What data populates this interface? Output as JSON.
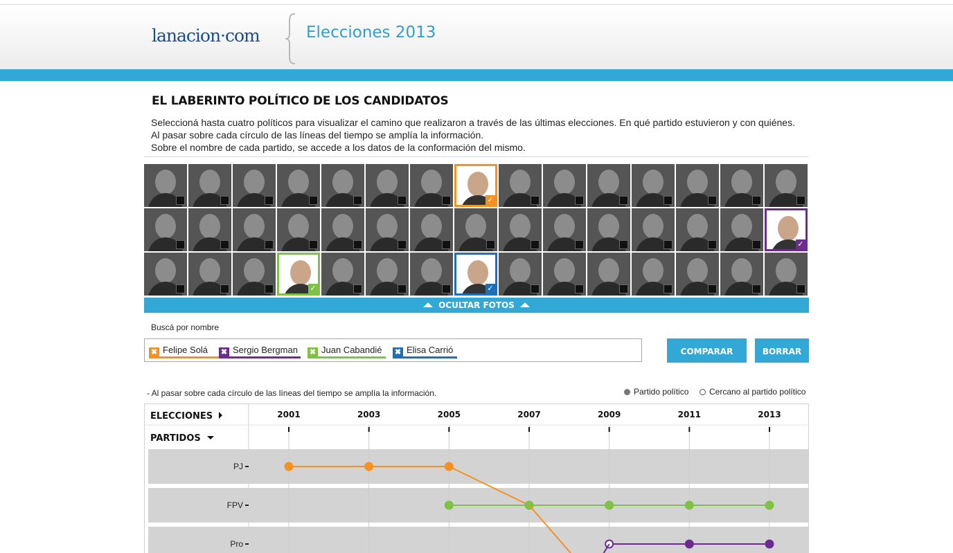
{
  "header": {
    "logo": "lanacion·com",
    "section": "Elecciones 2013"
  },
  "intro": {
    "title": "EL LABERINTO POLÍTICO DE LOS CANDIDATOS",
    "lines": [
      "Seleccioná hasta cuatro políticos para visualizar el camino que realizaron a través de las últimas elecciones. En qué partido estuvieron y con quiénes.",
      "Al pasar sobre cada círculo de las líneas del tiempo se amplía la información.",
      "Sobre el nombre de cada partido, se accede a los datos de la conformación del mismo."
    ]
  },
  "photo_grid": {
    "columns": 15,
    "rows": 3,
    "selected": [
      {
        "row": 0,
        "col": 7,
        "color": "#f39223"
      },
      {
        "row": 1,
        "col": 14,
        "color": "#6a2c8f"
      },
      {
        "row": 2,
        "col": 3,
        "color": "#7dc242"
      },
      {
        "row": 2,
        "col": 7,
        "color": "#1f6fb8"
      }
    ],
    "toggle_label": "OCULTAR FOTOS"
  },
  "search": {
    "label": "Buscá por nombre",
    "tags": [
      {
        "name": "Felipe Solá",
        "color": "#f39223"
      },
      {
        "name": "Sergio Bergman",
        "color": "#6a2c8f"
      },
      {
        "name": "Juan Cabandié",
        "color": "#7dc242"
      },
      {
        "name": "Elisa Carrió",
        "color": "#1f6fb8"
      }
    ],
    "compare_label": "COMPARAR",
    "clear_label": "BORRAR"
  },
  "chart_info": {
    "hint": "- Al pasar sobre cada círculo de las líneas del tiempo se amplía la información.",
    "legend_party": "Partido político",
    "legend_near": "Cercano al partido político",
    "elections_label": "ELECCIONES",
    "parties_label": "PARTIDOS"
  },
  "chart_data": {
    "type": "line",
    "x": [
      2001,
      2003,
      2005,
      2007,
      2009,
      2011,
      2013
    ],
    "categories": [
      "PJ",
      "FPV",
      "Pro"
    ],
    "series": [
      {
        "name": "Felipe Solá",
        "color": "#f39223",
        "points": [
          {
            "x": 2001,
            "party": "PJ",
            "type": "party"
          },
          {
            "x": 2003,
            "party": "PJ",
            "type": "party"
          },
          {
            "x": 2005,
            "party": "PJ",
            "type": "party"
          },
          {
            "x": 2007,
            "party": "FPV",
            "type": "party"
          }
        ]
      },
      {
        "name": "Juan Cabandié",
        "color": "#7dc242",
        "points": [
          {
            "x": 2005,
            "party": "FPV",
            "type": "party"
          },
          {
            "x": 2007,
            "party": "FPV",
            "type": "party"
          },
          {
            "x": 2009,
            "party": "FPV",
            "type": "party"
          },
          {
            "x": 2011,
            "party": "FPV",
            "type": "party"
          },
          {
            "x": 2013,
            "party": "FPV",
            "type": "party"
          }
        ]
      },
      {
        "name": "Sergio Bergman",
        "color": "#6a2c8f",
        "points": [
          {
            "x": 2009,
            "party": "Pro",
            "type": "near"
          },
          {
            "x": 2011,
            "party": "Pro",
            "type": "party"
          },
          {
            "x": 2013,
            "party": "Pro",
            "type": "party"
          }
        ]
      }
    ]
  }
}
